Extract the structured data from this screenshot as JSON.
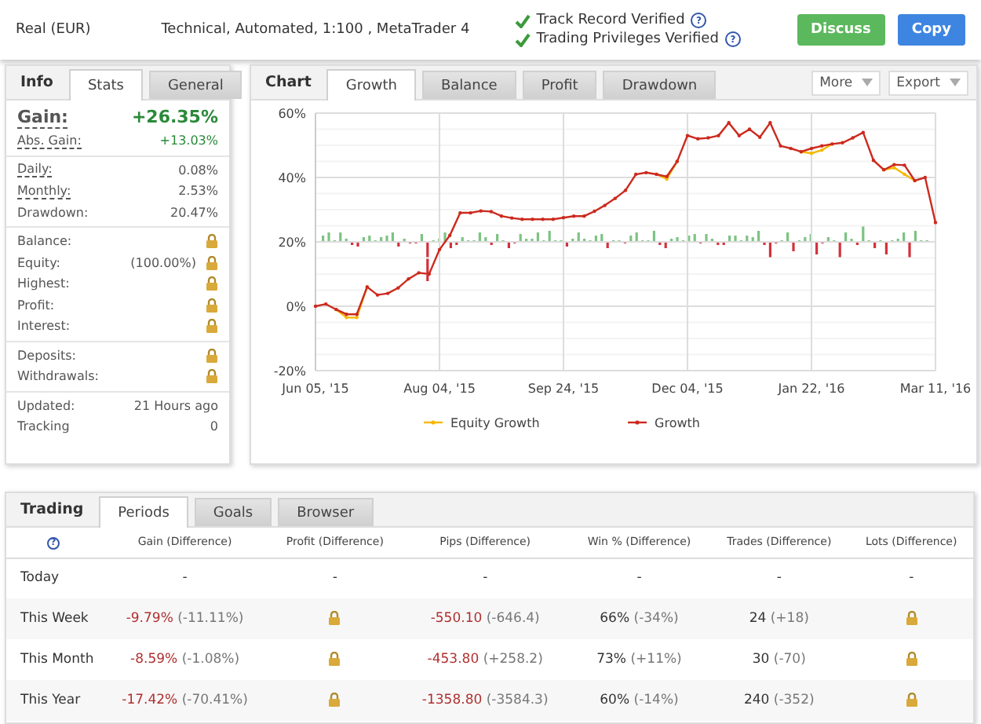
{
  "header": {
    "account": "Real (EUR)",
    "system": "Technical, Automated, 1:100 , MetaTrader 4",
    "verified": [
      {
        "label": "Track Record Verified",
        "help": "?"
      },
      {
        "label": "Trading Privileges Verified",
        "help": "?"
      }
    ],
    "buttons": [
      {
        "label": "Discuss",
        "color": "#5cb85c"
      },
      {
        "label": "Copy",
        "color": "#3d85e0"
      }
    ]
  },
  "info": {
    "title": "Info",
    "tabs": [
      {
        "label": "Stats",
        "selected": true
      },
      {
        "label": "General",
        "selected": false
      }
    ],
    "groups": [
      [
        {
          "kind": "headline",
          "label": "Gain:",
          "value": "+26.35%",
          "positive": true,
          "hint": true
        },
        {
          "kind": "value",
          "label": "Abs. Gain:",
          "value": "+13.03%",
          "positive": true,
          "hint": true
        }
      ],
      [
        {
          "kind": "value",
          "label": "Daily:",
          "value": "0.08%",
          "positive": false,
          "hint": true
        },
        {
          "kind": "value",
          "label": "Monthly:",
          "value": "2.53%",
          "positive": false,
          "hint": true
        },
        {
          "kind": "value",
          "label": "Drawdown:",
          "value": "20.47%",
          "positive": false,
          "hint": false
        }
      ],
      [
        {
          "kind": "locked",
          "label": "Balance:"
        },
        {
          "kind": "locked",
          "label": "Equity:",
          "note": "(100.00%)"
        },
        {
          "kind": "locked",
          "label": "Highest:"
        },
        {
          "kind": "locked",
          "label": "Profit:"
        },
        {
          "kind": "locked",
          "label": "Interest:"
        }
      ],
      [
        {
          "kind": "locked",
          "label": "Deposits:"
        },
        {
          "kind": "locked",
          "label": "Withdrawals:"
        }
      ],
      [
        {
          "kind": "value",
          "label": "Updated:",
          "value": "21 Hours ago",
          "positive": false,
          "hint": false
        },
        {
          "kind": "value",
          "label": "Tracking",
          "value": "0",
          "positive": false,
          "hint": false
        }
      ]
    ]
  },
  "chart": {
    "title": "Chart",
    "tabs": [
      {
        "label": "Growth",
        "selected": true
      },
      {
        "label": "Balance",
        "selected": false
      },
      {
        "label": "Profit",
        "selected": false
      },
      {
        "label": "Drawdown",
        "selected": false
      }
    ],
    "menus": [
      "More",
      "Export"
    ],
    "chart_data": {
      "type": "line",
      "categories": [
        "Jun 05, '15",
        null,
        null,
        null,
        null,
        null,
        null,
        null,
        null,
        null,
        null,
        null,
        "Aug 04, '15",
        null,
        null,
        null,
        null,
        null,
        null,
        null,
        null,
        null,
        null,
        null,
        "Sep 24, '15",
        null,
        null,
        null,
        null,
        null,
        null,
        null,
        null,
        null,
        null,
        null,
        "Dec 04, '15",
        null,
        null,
        null,
        null,
        null,
        null,
        null,
        null,
        null,
        null,
        null,
        "Jan 22, '16",
        null,
        null,
        null,
        null,
        null,
        null,
        null,
        null,
        null,
        null,
        null,
        "Mar 11, '16"
      ],
      "series": [
        {
          "name": "Equity Growth",
          "color": "#f5b800",
          "values": [
            null,
            null,
            -1,
            -3.5,
            -3.5,
            6,
            null,
            null,
            null,
            null,
            null,
            null,
            null,
            null,
            null,
            null,
            null,
            null,
            null,
            null,
            null,
            null,
            null,
            null,
            null,
            null,
            null,
            null,
            null,
            null,
            null,
            null,
            null,
            41,
            39.5,
            45,
            null,
            null,
            null,
            null,
            null,
            null,
            null,
            null,
            null,
            null,
            null,
            48,
            47.5,
            48.5,
            50.4,
            null,
            null,
            null,
            null,
            42.4,
            43,
            41,
            39,
            null,
            null
          ]
        },
        {
          "name": "Growth",
          "color": "#cc2a1e",
          "values": [
            0,
            0.7,
            -1,
            -2.5,
            -2.5,
            6,
            3.5,
            4,
            5.7,
            8.5,
            10.4,
            10,
            17.6,
            22,
            29,
            29,
            29.6,
            29.4,
            28,
            27.4,
            27,
            27,
            27,
            27,
            27.5,
            28,
            28,
            29.5,
            31.3,
            33.5,
            36,
            41,
            41.5,
            41,
            40.3,
            45,
            53,
            52,
            52.3,
            53,
            57,
            53,
            55,
            52.5,
            57,
            49.8,
            49,
            48,
            49,
            49.8,
            50.4,
            50.8,
            52.3,
            54,
            45.3,
            42.4,
            44,
            43.8,
            39,
            40,
            26
          ]
        }
      ],
      "ylim": [
        -20,
        60
      ],
      "grid": true,
      "legend": true,
      "yticks": [
        {
          "value": -20,
          "label": "-20%"
        },
        {
          "value": 0,
          "label": "0%"
        },
        {
          "value": 20,
          "label": "20%"
        },
        {
          "value": 40,
          "label": "40%"
        },
        {
          "value": 60,
          "label": "60%"
        }
      ]
    }
  },
  "trading": {
    "title": "Trading",
    "tabs": [
      {
        "label": "Periods",
        "selected": true
      },
      {
        "label": "Goals",
        "selected": false
      },
      {
        "label": "Browser",
        "selected": false
      }
    ],
    "corner": "?",
    "columns": [
      "Gain (Difference)",
      "Profit (Difference)",
      "Pips (Difference)",
      "Win % (Difference)",
      "Trades (Difference)",
      "Lots (Difference)"
    ],
    "rows": [
      {
        "period": "Today",
        "cells": [
          {
            "kind": "dash",
            "value": "-"
          },
          {
            "kind": "dash",
            "value": "-"
          },
          {
            "kind": "dash",
            "value": "-"
          },
          {
            "kind": "dash",
            "value": "-"
          },
          {
            "kind": "dash",
            "value": "-"
          },
          {
            "kind": "dash",
            "value": "-"
          }
        ]
      },
      {
        "period": "This Week",
        "cells": [
          {
            "kind": "value",
            "value": "-9.79%",
            "diff": "(-11.11%)",
            "negative": true
          },
          {
            "kind": "locked"
          },
          {
            "kind": "value",
            "value": "-550.10",
            "diff": "(-646.4)",
            "negative": true
          },
          {
            "kind": "value",
            "value": "66%",
            "diff": "(-34%)",
            "negative": false
          },
          {
            "kind": "value",
            "value": "24",
            "diff": "(+18)",
            "negative": false
          },
          {
            "kind": "locked"
          }
        ]
      },
      {
        "period": "This Month",
        "cells": [
          {
            "kind": "value",
            "value": "-8.59%",
            "diff": "(-1.08%)",
            "negative": true
          },
          {
            "kind": "locked"
          },
          {
            "kind": "value",
            "value": "-453.80",
            "diff": "(+258.2)",
            "negative": true
          },
          {
            "kind": "value",
            "value": "73%",
            "diff": "(+11%)",
            "negative": false
          },
          {
            "kind": "value",
            "value": "30",
            "diff": "(-70)",
            "negative": false
          },
          {
            "kind": "locked"
          }
        ]
      },
      {
        "period": "This Year",
        "cells": [
          {
            "kind": "value",
            "value": "-17.42%",
            "diff": "(-70.41%)",
            "negative": true
          },
          {
            "kind": "locked"
          },
          {
            "kind": "value",
            "value": "-1358.80",
            "diff": "(-3584.3)",
            "negative": true
          },
          {
            "kind": "value",
            "value": "60%",
            "diff": "(-14%)",
            "negative": false
          },
          {
            "kind": "value",
            "value": "240",
            "diff": "(-352)",
            "negative": false
          },
          {
            "kind": "locked"
          }
        ]
      }
    ]
  }
}
